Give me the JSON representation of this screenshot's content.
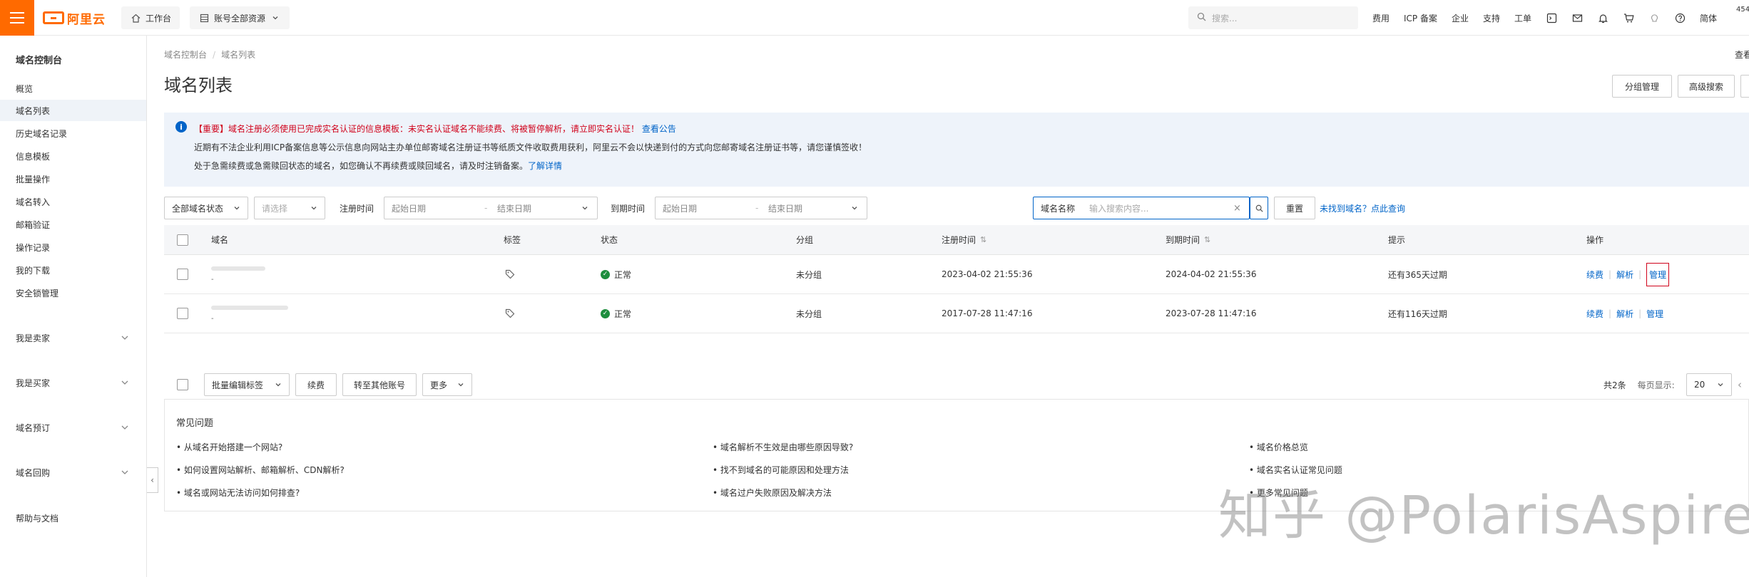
{
  "topbar": {
    "logo_text": "阿里云",
    "workbench_label": "工作台",
    "resource_label": "账号全部资源",
    "search_placeholder": "搜索...",
    "links": [
      "费用",
      "ICP 备案",
      "企业",
      "支持",
      "工单"
    ],
    "lang_label": "简体",
    "right_fragment": "454"
  },
  "sidebar": {
    "title": "域名控制台",
    "items": [
      "概览",
      "域名列表",
      "历史域名记录",
      "信息模板",
      "批量操作",
      "域名转入",
      "邮箱验证",
      "操作记录",
      "我的下载",
      "安全锁管理"
    ],
    "active_index": 1,
    "groups": [
      "我是卖家",
      "我是买家",
      "域名预订",
      "域名回购"
    ],
    "help_label": "帮助与文档"
  },
  "main": {
    "breadcrumb": [
      "域名控制台",
      "域名列表"
    ],
    "page_title": "域名列表",
    "header_buttons": [
      "分组管理",
      "高级搜索"
    ],
    "right_fragment": "查看"
  },
  "notice": {
    "line1_tag": "【重要】",
    "line1_text": "域名注册必须使用已完成实名认证的信息模板：未实名认证域名不能续费、将被暂停解析，请立即实名认证！",
    "line1_link": "查看公告",
    "line2_text": "近期有不法企业利用ICP备案信息等公示信息向网站主办单位邮寄域名注册证书等纸质文件收取费用获利，阿里云不会以快递到付的方式向您邮寄域名注册证书等，请您谨慎签收！",
    "line3_text": "处于急需续费或急需赎回状态的域名，如您确认不再续费或赎回域名，请及时注销备案。",
    "line3_link": "了解详情"
  },
  "filter": {
    "status_select": "全部域名状态",
    "type_select_placeholder": "请选择",
    "reg_time_label": "注册时间",
    "exp_time_label": "到期时间",
    "start_placeholder": "起始日期",
    "end_placeholder": "结束日期",
    "range_sep": "-",
    "search_field": "域名名称",
    "search_placeholder": "输入搜索内容...",
    "reset_label": "重置",
    "not_found_link": "未找到域名？点此查询"
  },
  "table": {
    "columns": [
      "域名",
      "标签",
      "状态",
      "分组",
      "注册时间",
      "到期时间",
      "提示",
      "操作"
    ],
    "rows": [
      {
        "status": "正常",
        "group": "未分组",
        "reg_time": "2023-04-02 21:55:36",
        "exp_time": "2024-04-02 21:55:36",
        "hint": "还有365天过期",
        "sub": "-"
      },
      {
        "status": "正常",
        "group": "未分组",
        "reg_time": "2017-07-28 11:47:16",
        "exp_time": "2023-07-28 11:47:16",
        "hint": "还有116天过期",
        "sub": "-"
      }
    ],
    "ops": [
      "续费",
      "解析",
      "管理"
    ]
  },
  "bulk": {
    "tag_select": "批量编辑标签",
    "renew_label": "续费",
    "transfer_label": "转至其他账号",
    "more_label": "更多",
    "total_label": "共2条",
    "per_page_label": "每页显示:",
    "per_page_value": "20"
  },
  "faq": {
    "title": "常见问题",
    "col1": [
      "从域名开始搭建一个网站?",
      "如何设置网站解析、邮箱解析、CDN解析?",
      "域名或网站无法访问如何排查?"
    ],
    "col2": [
      "域名解析不生效是由哪些原因导致?",
      "找不到域名的可能原因和处理方法",
      "域名过户失败原因及解决方法"
    ],
    "col3": [
      "域名价格总览",
      "域名实名认证常见问题",
      "更多常见问题"
    ]
  },
  "watermark": "知乎 @PolarisAspire",
  "colors": {
    "brand": "#ff6a00",
    "link": "#0064c8",
    "ok": "#1e8e3e",
    "alert": "#d0021b"
  }
}
